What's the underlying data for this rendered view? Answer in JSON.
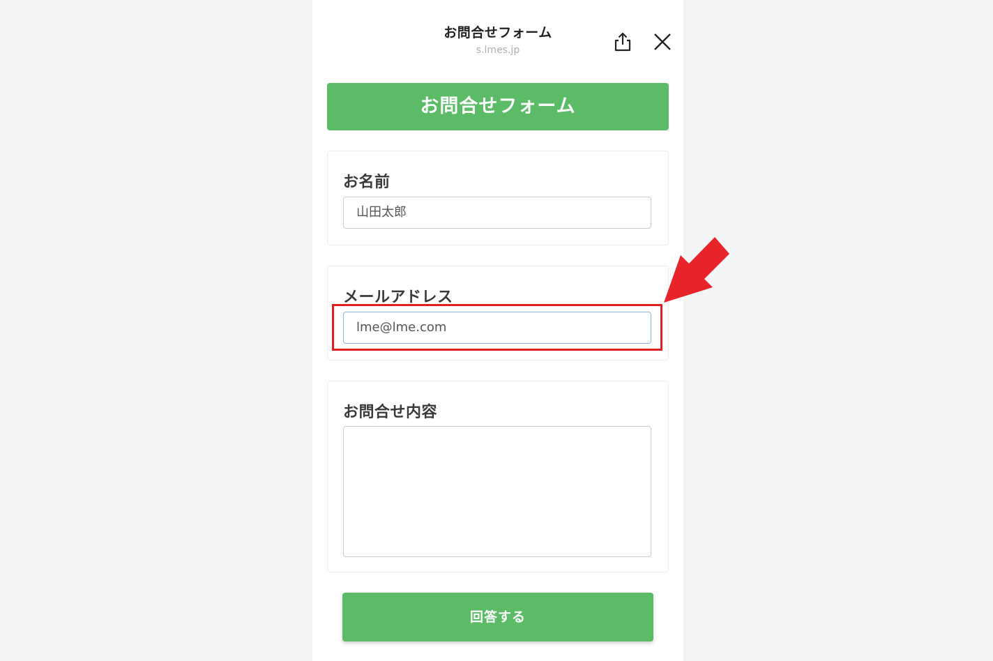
{
  "browser_bar": {
    "title": "お問合せフォーム",
    "url": "s.lmes.jp"
  },
  "form": {
    "header_title": "お問合せフォーム",
    "name_label": "お名前",
    "name_value": "山田太郎",
    "email_label": "メールアドレス",
    "email_value": "lme@lme.com",
    "inquiry_label": "お問合せ内容",
    "inquiry_value": "",
    "submit_label": "回答する"
  },
  "colors": {
    "accent_green": "#5bbb66",
    "highlight_red": "#e02020",
    "page_background": "#f3f4f6"
  },
  "icons": {
    "share": "share-icon",
    "close": "close-icon",
    "annotation_arrow": "arrow-icon"
  }
}
